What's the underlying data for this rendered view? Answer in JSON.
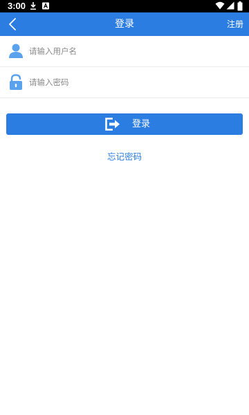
{
  "status_bar": {
    "time": "3:00"
  },
  "app_bar": {
    "title": "登录",
    "register_label": "注册"
  },
  "form": {
    "username": {
      "placeholder": "请输入用户名",
      "value": "",
      "icon": "user-icon"
    },
    "password": {
      "placeholder": "请输入密码",
      "value": "",
      "icon": "lock-icon"
    }
  },
  "login_button": {
    "label": "登录",
    "icon": "login-icon"
  },
  "forgot_password": {
    "label": "忘记密码"
  },
  "colors": {
    "primary": "#2b7de1",
    "icon_blue": "#5aa2ee",
    "status_bar": "#000000"
  }
}
